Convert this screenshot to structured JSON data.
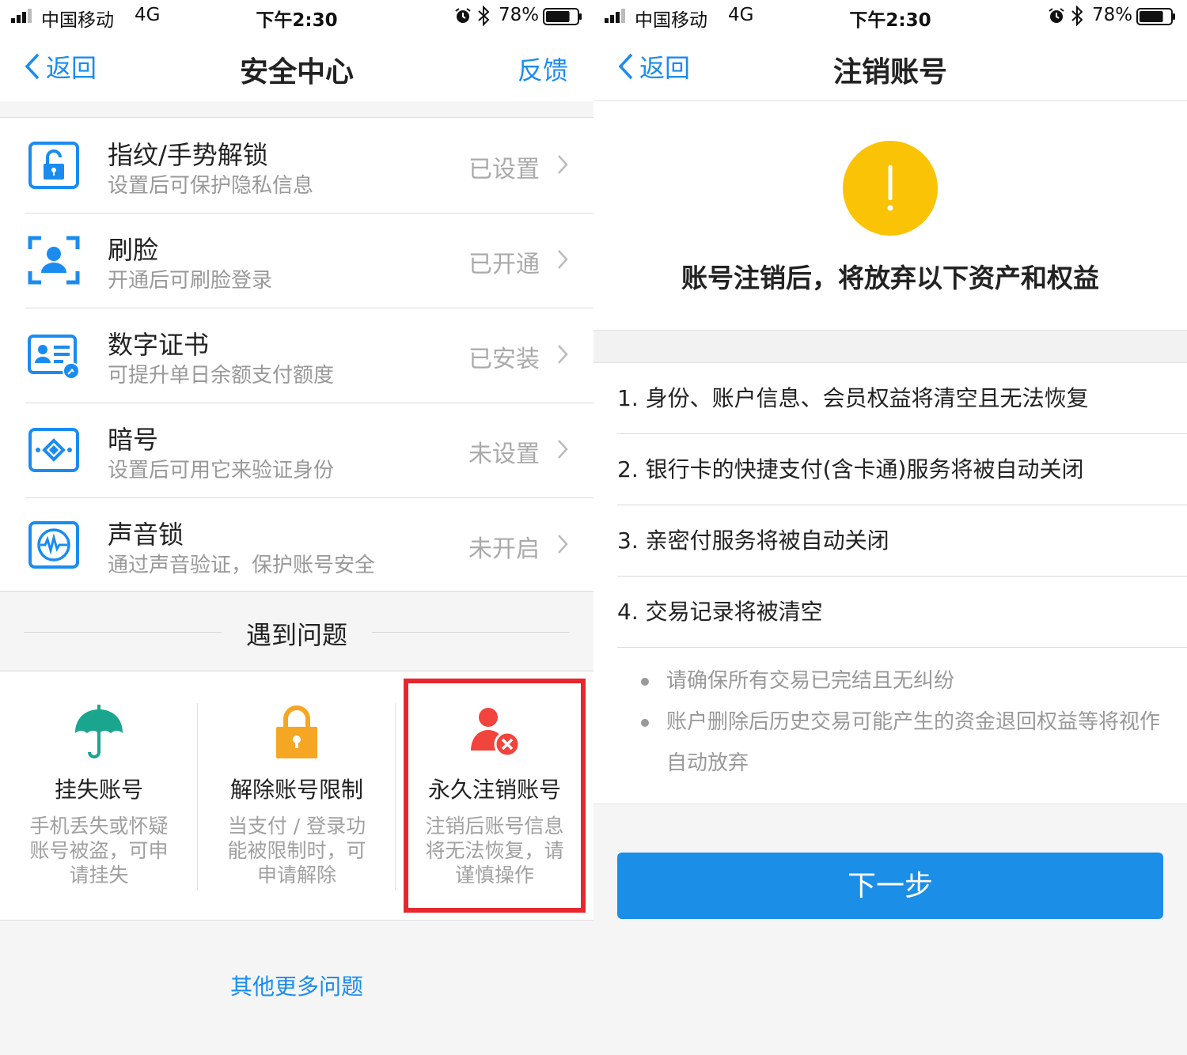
{
  "status_bar": {
    "carrier": "中国移动",
    "network": "4G",
    "time": "下午2:30",
    "battery_percent": "78%",
    "battery_level": 0.78
  },
  "left": {
    "nav": {
      "back_label": "返回",
      "title": "安全中心",
      "feedback_label": "反馈"
    },
    "security_items": [
      {
        "name": "指纹/手势解锁",
        "desc": "设置后可保护隐私信息",
        "status": "已设置",
        "icon": "lock-icon"
      },
      {
        "name": "刷脸",
        "desc": "开通后可刷脸登录",
        "status": "已开通",
        "icon": "face-scan-icon"
      },
      {
        "name": "数字证书",
        "desc": "可提升单日余额支付额度",
        "status": "已安装",
        "icon": "certificate-icon"
      },
      {
        "name": "暗号",
        "desc": "设置后可用它来验证身份",
        "status": "未设置",
        "icon": "code-diamond-icon"
      },
      {
        "name": "声音锁",
        "desc": "通过声音验证，保护账号安全",
        "status": "未开启",
        "icon": "voice-wave-icon"
      }
    ],
    "problems_title": "遇到问题",
    "problem_cards": [
      {
        "title": "挂失账号",
        "desc": "手机丢失或怀疑账号被盗，可申请挂失",
        "icon": "umbrella-icon",
        "color": "#1aa58e"
      },
      {
        "title": "解除账号限制",
        "desc": "当支付 / 登录功能被限制时，可申请解除",
        "icon": "padlock-icon",
        "color": "#f5a623"
      },
      {
        "title": "永久注销账号",
        "desc": "注销后账号信息将无法恢复，请谨慎操作",
        "icon": "user-remove-icon",
        "color": "#f0443c"
      }
    ],
    "more_link": "其他更多问题"
  },
  "right": {
    "nav": {
      "back_label": "返回",
      "title": "注销账号"
    },
    "warning_heading": "账号注销后，将放弃以下资产和权益",
    "items": [
      "1. 身份、账户信息、会员权益将清空且无法恢复",
      "2. 银行卡的快捷支付(含卡通)服务将被自动关闭",
      "3. 亲密付服务将被自动关闭",
      "4. 交易记录将被清空"
    ],
    "notes": [
      "请确保所有交易已完结且无纠纷",
      "账户删除后历史交易可能产生的资金退回权益等将视作自动放弃"
    ],
    "next_button": "下一步"
  },
  "colors": {
    "accent_blue": "#1a8cf0",
    "button_blue": "#1b8ee8",
    "warning_yellow": "#fbc305",
    "highlight_red": "#e8262d"
  }
}
